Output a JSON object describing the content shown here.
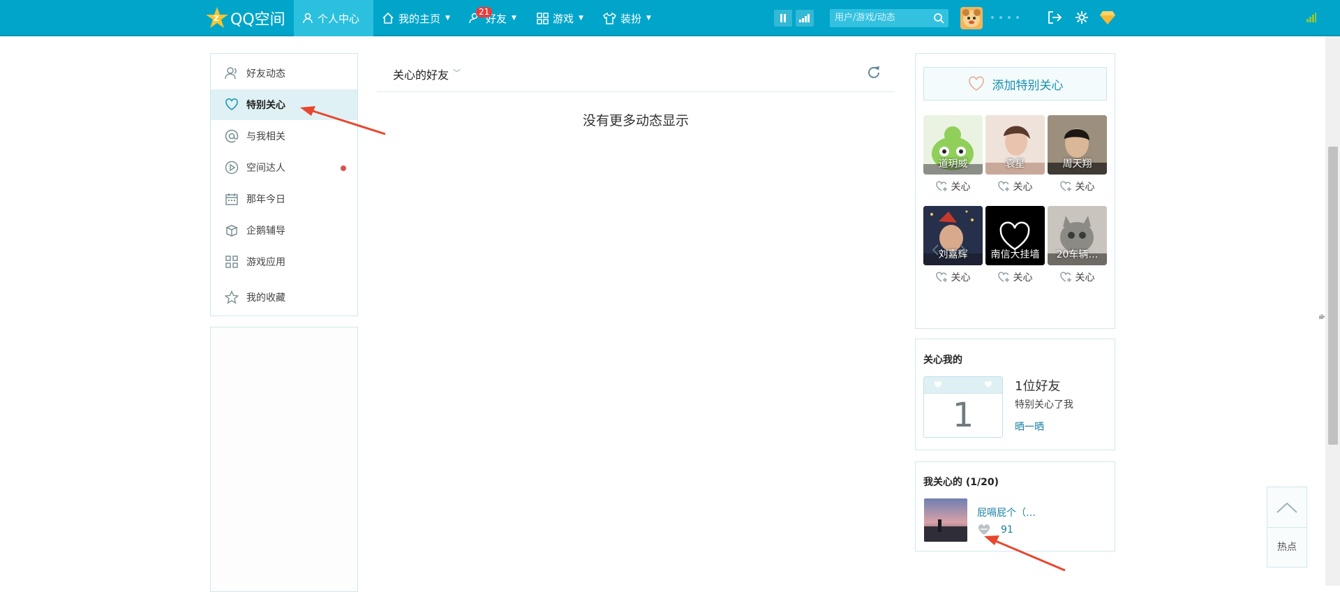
{
  "topbar": {
    "logo_text": "QQ空间",
    "nav": [
      {
        "label": "个人中心",
        "icon": "person-icon",
        "active": true
      },
      {
        "label": "我的主页",
        "icon": "home-icon",
        "caret": true
      },
      {
        "label": "好友",
        "icon": "friends-icon",
        "caret": true,
        "badge": "21"
      },
      {
        "label": "游戏",
        "icon": "grid-icon",
        "caret": true
      },
      {
        "label": "装扮",
        "icon": "shirt-icon",
        "caret": true
      }
    ],
    "search_placeholder": "用户/游戏/动态",
    "accent_color": "#00a5c9"
  },
  "sidebar": {
    "items": [
      {
        "label": "好友动态",
        "icon": "friends-feed-icon"
      },
      {
        "label": "特别关心",
        "icon": "heart-icon",
        "active": true
      },
      {
        "label": "与我相关",
        "icon": "at-icon"
      },
      {
        "label": "空间达人",
        "icon": "play-circle-icon",
        "dot": true
      },
      {
        "label": "那年今日",
        "icon": "calendar-icon"
      },
      {
        "label": "企鹅辅导",
        "icon": "books-icon"
      },
      {
        "label": "游戏应用",
        "icon": "apps-icon"
      },
      {
        "label": "我的收藏",
        "icon": "star-icon"
      }
    ]
  },
  "feed": {
    "title": "关心的好友",
    "empty_text": "没有更多动态显示"
  },
  "special_care": {
    "add_label": "添加特别关心",
    "friends": [
      {
        "name": "道玥威",
        "care_label": "关心"
      },
      {
        "name": "袁星",
        "care_label": "关心"
      },
      {
        "name": "周天翔",
        "care_label": "关心"
      },
      {
        "name": "刘嘉辉",
        "care_label": "关心"
      },
      {
        "name": "南信大挂墙",
        "care_label": "关心"
      },
      {
        "name": "20车辆…",
        "care_label": "关心"
      }
    ]
  },
  "cares_me": {
    "title": "关心我的",
    "count": "1",
    "friends_text": "1位好友",
    "sub_text": "特别关心了我",
    "link": "晒一晒"
  },
  "my_care": {
    "title": "我关心的 (1/20)",
    "item": {
      "name": "屁嗝屁个（…",
      "count": "91"
    }
  },
  "float": {
    "hot_label": "热点"
  }
}
